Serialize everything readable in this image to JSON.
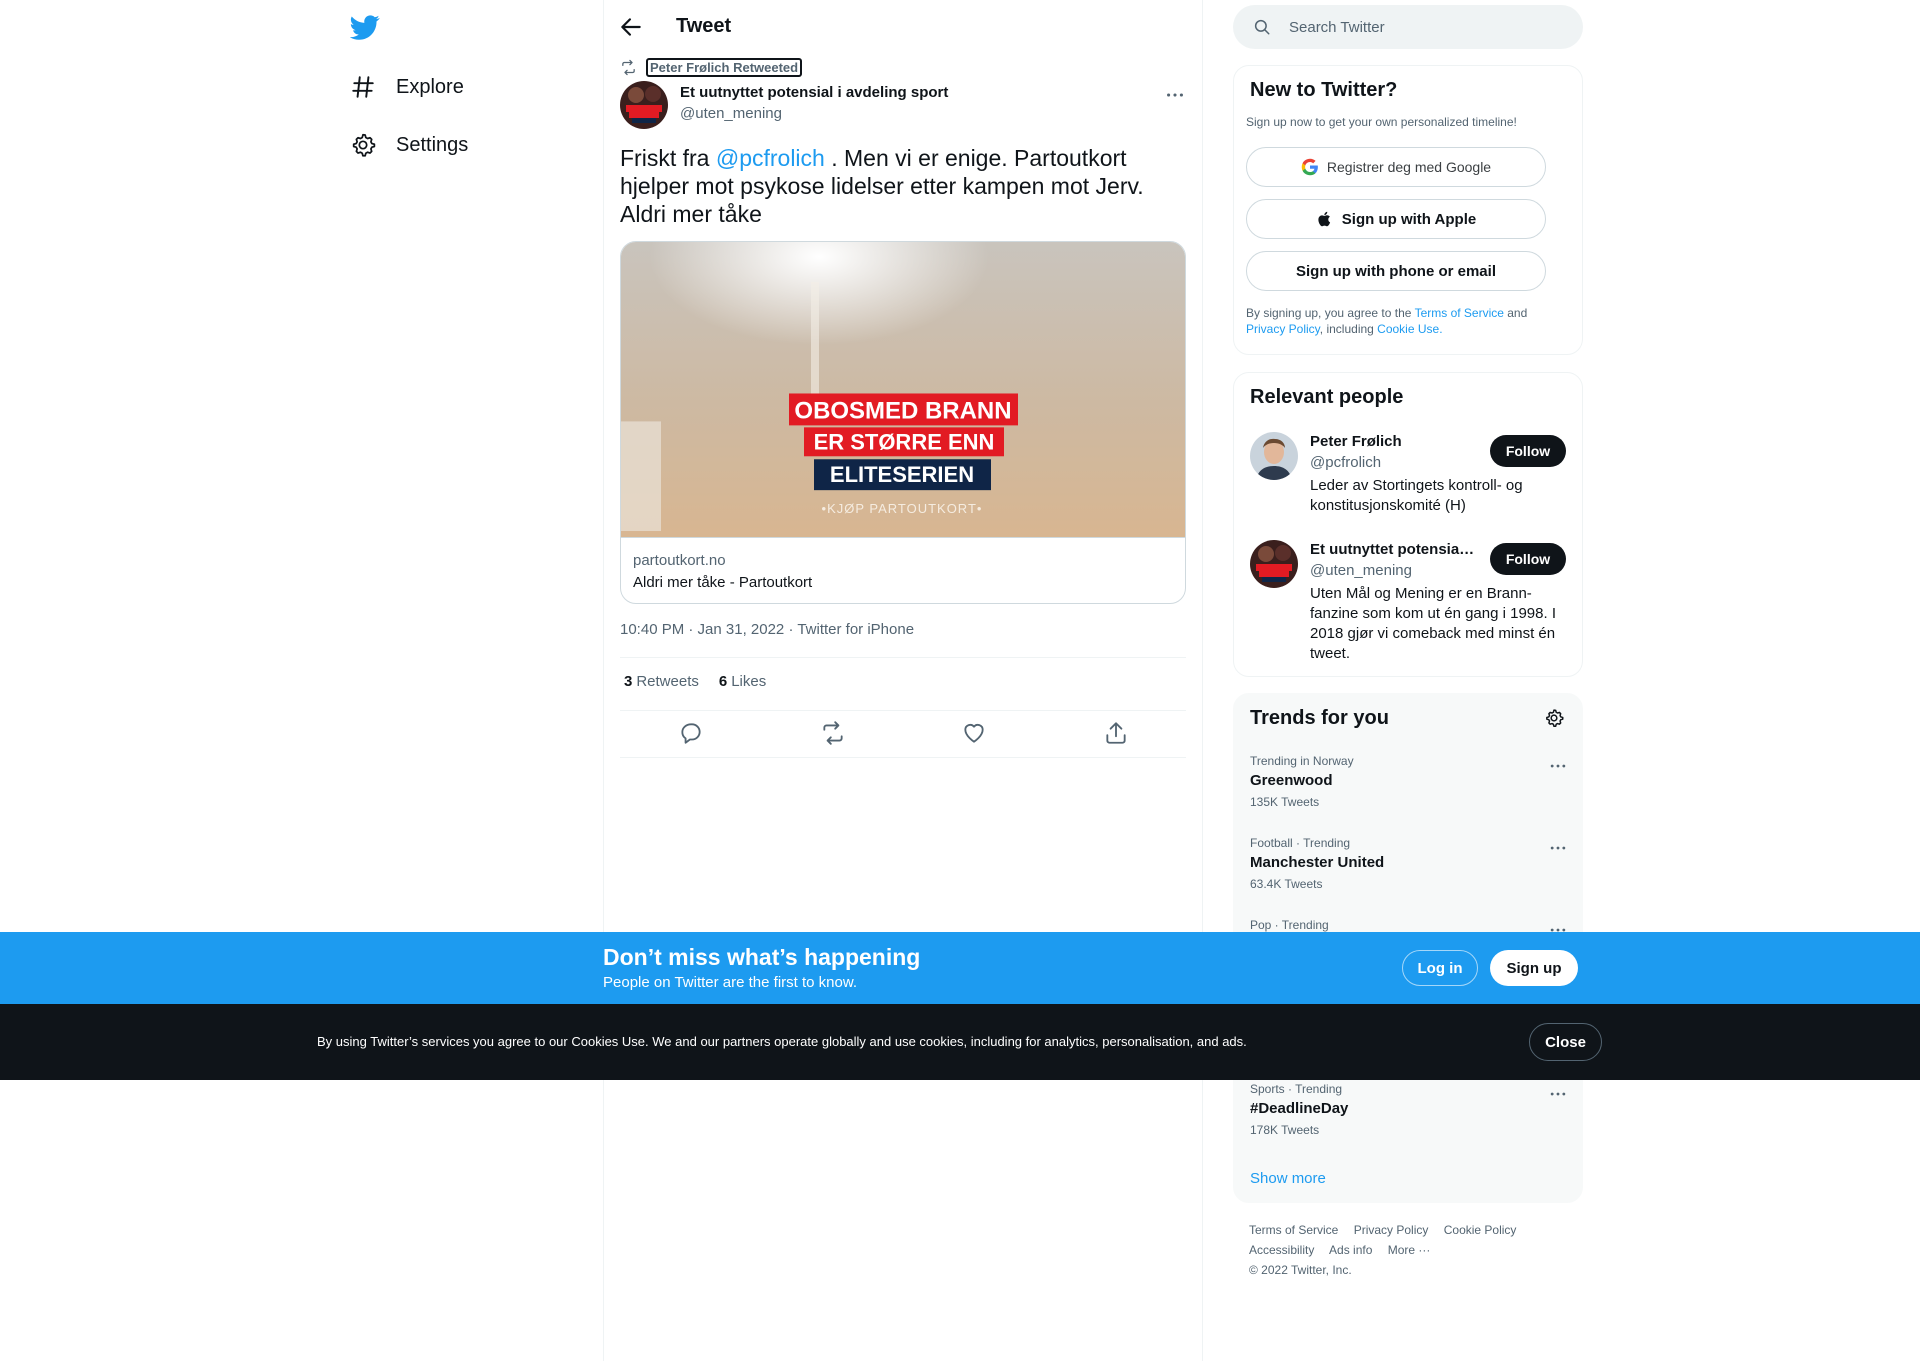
{
  "nav": {
    "items": [
      {
        "label": "Explore",
        "icon": "hashtag-icon"
      },
      {
        "label": "Settings",
        "icon": "gear-icon"
      }
    ]
  },
  "header": {
    "title": "Tweet"
  },
  "tweet": {
    "retweeted_by": "Peter Frølich Retweeted",
    "author_name": "Et uutnyttet potensial i avdeling sport",
    "author_handle": "@uten_mening",
    "text_before": "Friskt fra ",
    "mention": "@pcfrolich",
    "text_after": " . Men vi er enige. Partoutkort hjelper mot psykose lidelser etter kampen mot Jerv. Aldri mer tåke",
    "card": {
      "banner_line1": "OBOSMED BRANN",
      "banner_line2": "ER STØRRE ENN",
      "banner_line3": "ELITESERIEN",
      "banner_sub": "•KJØP PARTOUTKORT•",
      "domain": "partoutkort.no",
      "title": "Aldri mer tåke - Partoutkort"
    },
    "timestamp": "10:40 PM · Jan 31, 2022 · Twitter for iPhone",
    "retweets_count": "3",
    "retweets_label": "Retweets",
    "likes_count": "6",
    "likes_label": "Likes"
  },
  "search": {
    "placeholder": "Search Twitter"
  },
  "new_to_twitter": {
    "title": "New to Twitter?",
    "subtitle": "Sign up now to get your own personalized timeline!",
    "google_label": "Registrer deg med Google",
    "apple_label": "Sign up with Apple",
    "phone_label": "Sign up with phone or email",
    "legal_1": "By signing up, you agree to the ",
    "legal_tos": "Terms of Service",
    "legal_2": " and ",
    "legal_privacy": "Privacy Policy",
    "legal_3": ", including ",
    "legal_cookie": "Cookie Use."
  },
  "relevant_people": {
    "title": "Relevant people",
    "people": [
      {
        "name": "Peter Frølich",
        "handle": "@pcfrolich",
        "bio": "Leder av Stortingets kontroll- og konstitusjonskomité (H)",
        "follow": "Follow"
      },
      {
        "name": "Et uutnyttet potensial i avdeling sport",
        "handle": "@uten_mening",
        "bio": "Uten Mål og Mening er en Brann-fanzine som kom ut én gang i 1998. I 2018 gjør vi comeback med minst én tweet.",
        "follow": "Follow"
      }
    ]
  },
  "trends": {
    "title": "Trends for you",
    "items": [
      {
        "context": "Trending in Norway",
        "name": "Greenwood",
        "count": "135K Tweets"
      },
      {
        "context": "Football · Trending",
        "name": "Manchester United",
        "count": "63.4K Tweets"
      },
      {
        "context": "Pop · Trending",
        "name": "",
        "count": ""
      },
      {
        "context": "Sports · Trending",
        "name": "#DeadlineDay",
        "count": "178K Tweets"
      }
    ],
    "show_more": "Show more"
  },
  "footer": {
    "links": [
      "Terms of Service",
      "Privacy Policy",
      "Cookie Policy",
      "Accessibility",
      "Ads info",
      "More ···"
    ],
    "copyright": "© 2022 Twitter, Inc."
  },
  "login_bar": {
    "title": "Don’t miss what’s happening",
    "subtitle": "People on Twitter are the first to know.",
    "login": "Log in",
    "signup": "Sign up"
  },
  "cookie_bar": {
    "text": "By using Twitter’s services you agree to our Cookies Use. We and our partners operate globally and use cookies, including for analytics, personalisation, and ads.",
    "close": "Close"
  },
  "colors": {
    "accent": "#1d9bf0",
    "text_primary": "#0f1419",
    "text_secondary": "#536471",
    "banner_red": "#e21b23",
    "banner_navy": "#0f2547"
  }
}
